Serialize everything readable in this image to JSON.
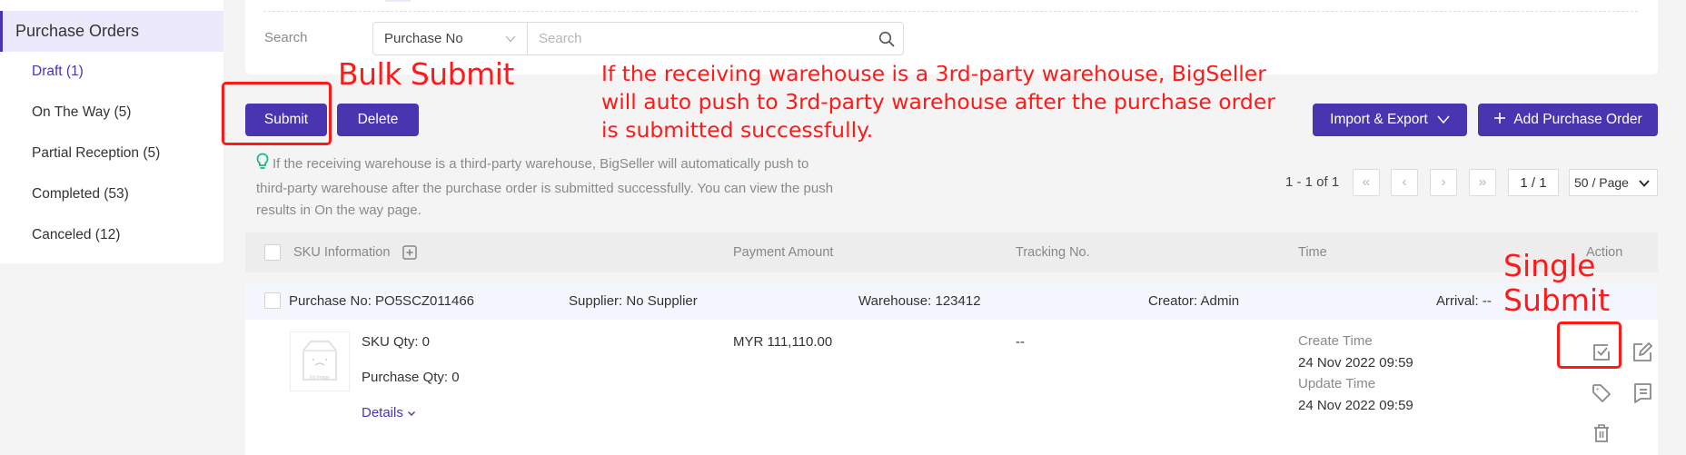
{
  "sidebar": {
    "header": "Purchase Orders",
    "items": [
      {
        "label": "Draft (1)",
        "active": true
      },
      {
        "label": "On The Way (5)"
      },
      {
        "label": "Partial Reception (5)"
      },
      {
        "label": "Completed (53)"
      },
      {
        "label": "Canceled (12)"
      }
    ]
  },
  "search": {
    "label": "Search",
    "field_select": "Purchase No",
    "placeholder": "Search",
    "value": ""
  },
  "toolbar": {
    "submit_label": "Submit",
    "delete_label": "Delete",
    "import_export_label": "Import & Export",
    "add_label": "Add Purchase Order"
  },
  "annotations": {
    "bulk_submit": "Bulk Submit",
    "paragraph_lines": [
      "If the receiving warehouse is a 3rd-party warehouse, BigSeller",
      "will auto push to 3rd-party warehouse after the purchase order",
      "is submitted successfully."
    ],
    "single_submit_lines": [
      "Single",
      "Submit"
    ]
  },
  "tip": {
    "lines": [
      "If the receiving warehouse is a third-party warehouse, BigSeller will automatically push to",
      "third-party warehouse after the purchase order is submitted successfully. You can view the push",
      "results in On the way page."
    ]
  },
  "pagination": {
    "range_text": "1 - 1 of 1",
    "page_text": "1 / 1",
    "page_size": "50 / Page"
  },
  "table": {
    "columns": [
      "SKU Information",
      "Payment Amount",
      "Tracking No.",
      "Time",
      "Action"
    ],
    "rows": [
      {
        "purchase_no": "Purchase No:  PO5SCZ011466",
        "supplier": "Supplier: No Supplier",
        "warehouse": "Warehouse: 123412",
        "creator": "Creator: Admin",
        "arrival": "Arrival: --",
        "image_placeholder": "No Image",
        "sku_qty": "SKU Qty: 0",
        "purchase_qty": "Purchase Qty: 0",
        "details_label": "Details",
        "payment_amount": "MYR 111,110.00",
        "tracking_no": "--",
        "create_time_label": "Create Time",
        "create_time": "24 Nov 2022 09:59",
        "update_time_label": "Update Time",
        "update_time": "24 Nov 2022 09:59"
      }
    ]
  },
  "colors": {
    "brand": "#4a35b1",
    "annotation_red": "#ff1a1a",
    "tip_bulb": "#16b88b"
  }
}
